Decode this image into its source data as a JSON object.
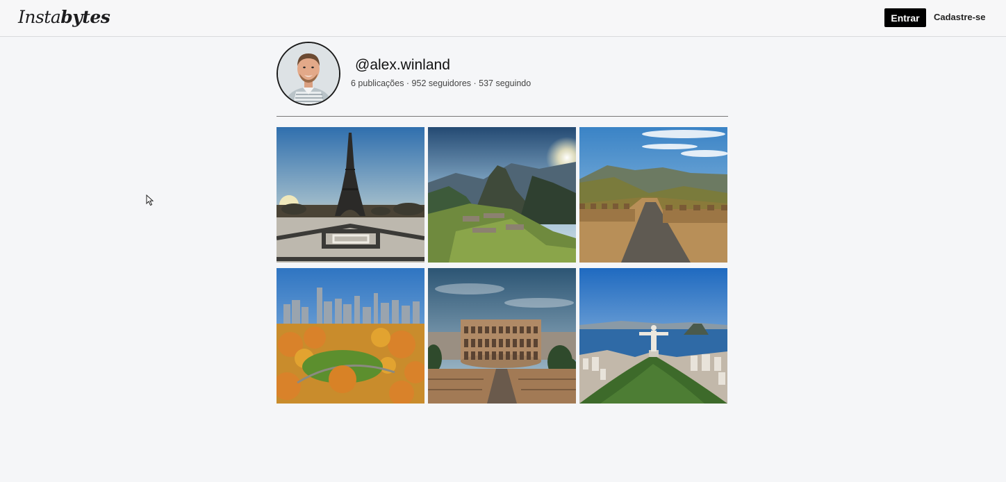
{
  "header": {
    "logo_part1": "Insta",
    "logo_part2": "bytes",
    "login_label": "Entrar",
    "signup_label": "Cadastre-se"
  },
  "profile": {
    "username": "@alex.winland",
    "stats": "6 publicações · 952 seguidores · 537 seguindo"
  },
  "posts": [
    {
      "subject": "eiffel-tower"
    },
    {
      "subject": "machu-picchu"
    },
    {
      "subject": "great-wall"
    },
    {
      "subject": "central-park"
    },
    {
      "subject": "colosseum"
    },
    {
      "subject": "christ-the-redeemer"
    }
  ]
}
